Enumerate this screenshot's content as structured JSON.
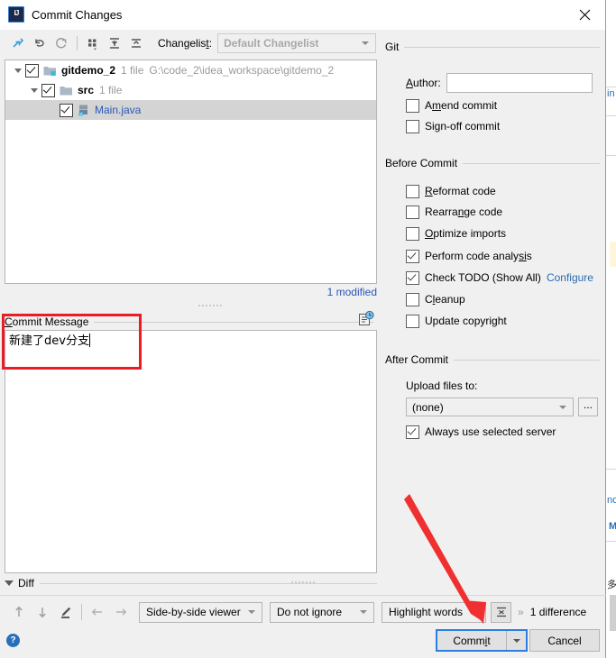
{
  "window": {
    "title": "Commit Changes",
    "app_icon": "intellij-idea-icon",
    "close_icon": "close-icon"
  },
  "toolbar": {
    "icons": [
      {
        "name": "move-to-changelist-icon",
        "label": "Move to Another Changelist"
      },
      {
        "name": "rollback-icon",
        "label": "Revert"
      },
      {
        "name": "refresh-icon",
        "label": "Refresh"
      },
      {
        "name": "group-by-icon",
        "label": "Group By"
      },
      {
        "name": "expand-all-icon",
        "label": "Expand All"
      },
      {
        "name": "collapse-all-icon",
        "label": "Collapse All"
      }
    ],
    "changelist_label": "Changelist:",
    "changelist_value": "Default Changelist"
  },
  "file_tree": {
    "rows": [
      {
        "name": "gitdemo_2",
        "meta": "1 file",
        "path": "G:\\code_2\\idea_workspace\\gitdemo_2",
        "icon": "module-folder-icon",
        "checked": true,
        "expanded": true,
        "depth": 0,
        "selected": false,
        "is_file": false
      },
      {
        "name": "src",
        "meta": "1 file",
        "path": "",
        "icon": "folder-icon",
        "checked": true,
        "expanded": true,
        "depth": 1,
        "selected": false,
        "is_file": false
      },
      {
        "name": "Main.java",
        "meta": "",
        "path": "",
        "icon": "java-file-icon",
        "checked": true,
        "expanded": null,
        "depth": 2,
        "selected": true,
        "is_file": true
      }
    ],
    "modified_count": "1 modified"
  },
  "commit_message": {
    "section_label": "Commit Message",
    "value": "新建了dev分支",
    "history_icon": "commit-message-history-icon"
  },
  "diff_section": {
    "label": "Diff",
    "collapsed": true
  },
  "git_section": {
    "title": "Git",
    "author_label": "Author:",
    "author_value": "",
    "author_placeholder": "",
    "checkboxes": [
      {
        "label": "Amend commit",
        "checked": false,
        "mnemonic": "A"
      },
      {
        "label": "Sign-off commit",
        "checked": false,
        "mnemonic": "g"
      }
    ]
  },
  "before_commit_section": {
    "title": "Before Commit",
    "checkboxes": [
      {
        "label": "Reformat code",
        "checked": false,
        "mnemonic": "R"
      },
      {
        "label": "Rearrange code",
        "checked": false,
        "mnemonic": "n"
      },
      {
        "label": "Optimize imports",
        "checked": false,
        "mnemonic": "O"
      },
      {
        "label": "Perform code analysis",
        "checked": true,
        "mnemonic": "si"
      },
      {
        "label": "Check TODO (Show All)",
        "checked": true,
        "mnemonic": "",
        "link": "Configure"
      },
      {
        "label": "Cleanup",
        "checked": false,
        "mnemonic": "l"
      },
      {
        "label": "Update copyright",
        "checked": false,
        "mnemonic": ""
      }
    ]
  },
  "after_commit_section": {
    "title": "After Commit",
    "upload_label": "Upload files to:",
    "upload_value": "(none)",
    "browse_label": "...",
    "always_use_label": "Always use selected server",
    "always_use_checked": true
  },
  "diff_toolbar": {
    "icons": [
      {
        "name": "previous-difference-icon",
        "glyph": "↑"
      },
      {
        "name": "next-difference-icon",
        "glyph": "↓"
      },
      {
        "name": "edit-source-icon",
        "glyph": "pencil"
      },
      {
        "name": "previous-file-icon",
        "glyph": "←"
      },
      {
        "name": "next-file-icon",
        "glyph": "→"
      }
    ],
    "viewer_mode": "Side-by-side viewer",
    "ignore_mode": "Do not ignore",
    "highlight_mode": "Highlight words",
    "collapse_icon": "collapse-unchanged-icon",
    "overflow_label": "»",
    "difference_count": "1 difference"
  },
  "actions": {
    "help_label": "?",
    "commit_label": "Commit",
    "commit_mnemonic": "i",
    "commit_dropdown_icon": "chevron-down-icon",
    "cancel_label": "Cancel"
  },
  "annotations": {
    "rect_color": "#ec1c24",
    "arrow_color": "#f03030",
    "arrow_target": "commit-button"
  },
  "background": {
    "text_fragments": [
      "in",
      "no",
      "M",
      "多"
    ]
  },
  "colors": {
    "dialog_bg": "#f0f0f0",
    "field_bg": "#ffffff",
    "link_blue": "#2b6cb0",
    "selection_gray": "#d4d4d4",
    "focus_blue": "#2a7fe0",
    "annotation_red": "#ec1c24"
  }
}
